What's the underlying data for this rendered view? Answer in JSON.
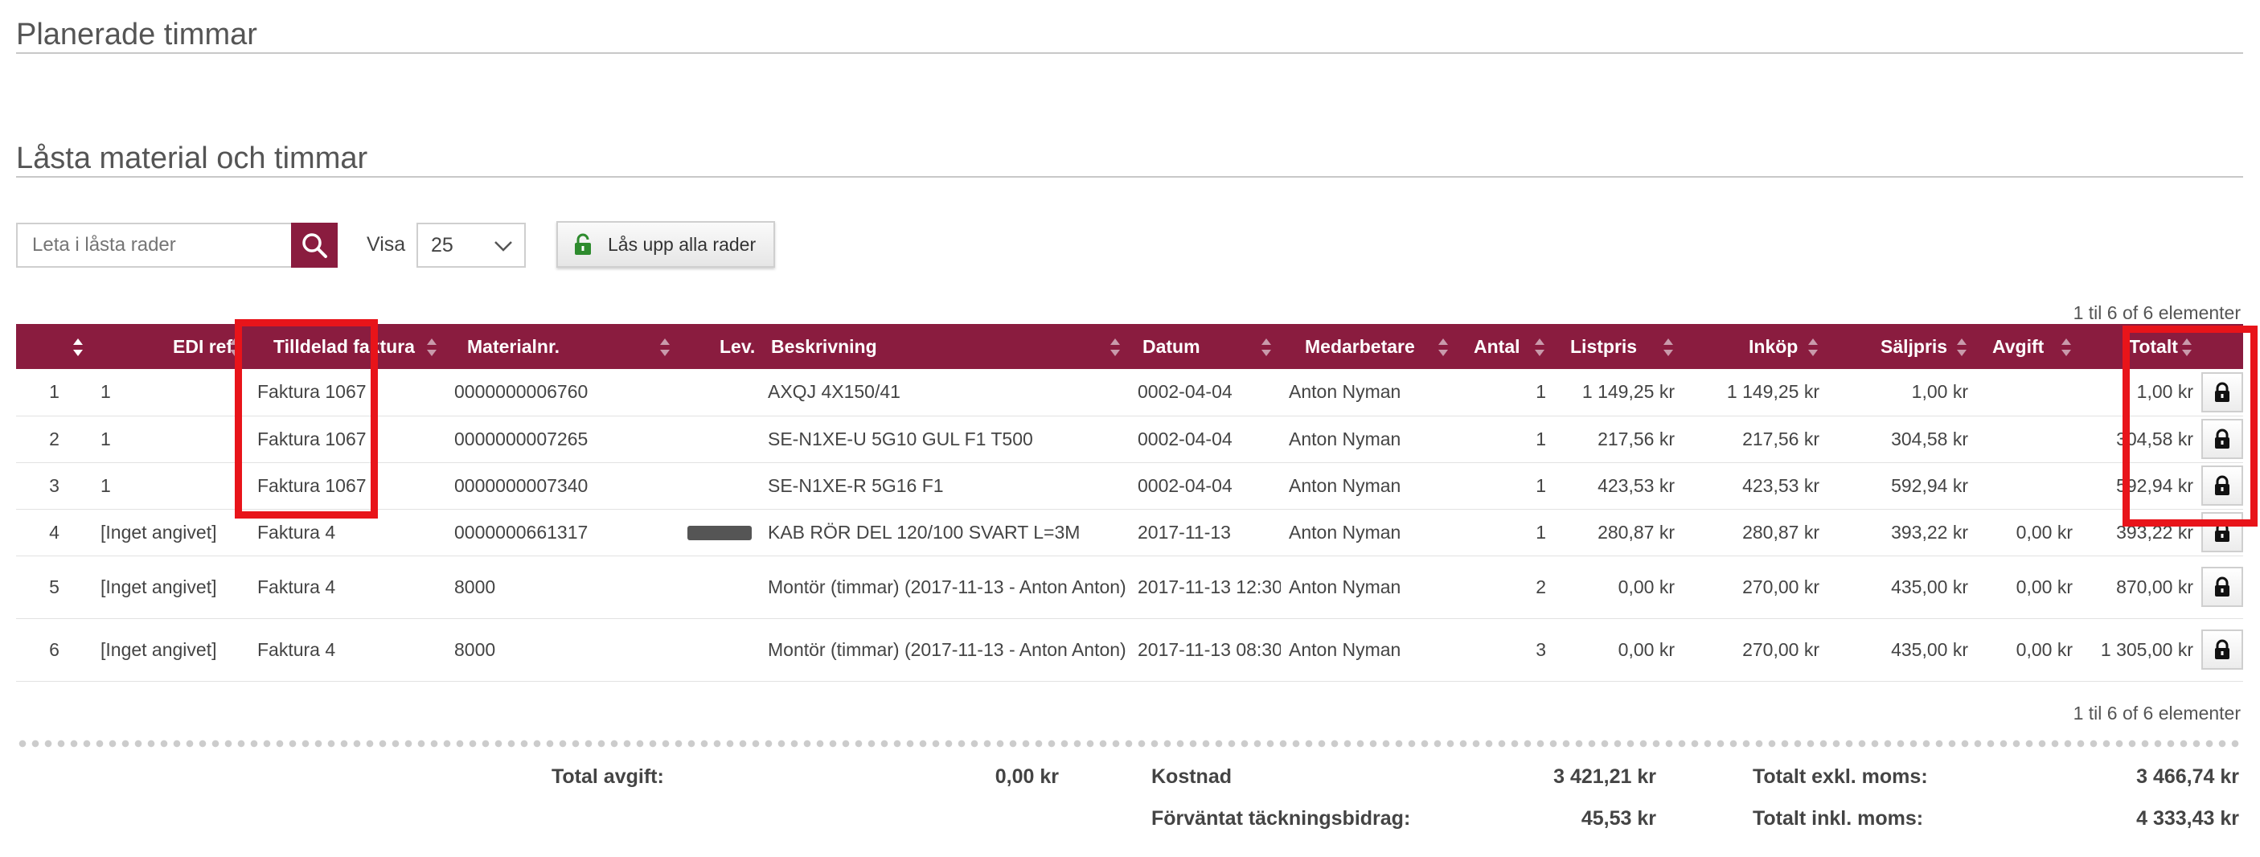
{
  "sections": {
    "planned_hours_title": "Planerade timmar",
    "locked_title": "Låsta material och timmar"
  },
  "toolbar": {
    "search_placeholder": "Leta i låsta rader",
    "show_label": "Visa",
    "page_size": "25",
    "unlock_all_label": "Lås upp alla rader"
  },
  "pager": {
    "top": "1 til 6 of 6 elementer",
    "bottom": "1 til 6 of 6 elementer"
  },
  "table": {
    "columns": [
      "",
      "EDI ref.",
      "Tilldelad faktura",
      "Materialnr.",
      "Lev.",
      "Beskrivning",
      "Datum",
      "Medarbetare",
      "Antal",
      "Listpris",
      "Inköp",
      "Säljpris",
      "Avgift",
      "Totalt",
      ""
    ],
    "rows": [
      {
        "n": "1",
        "edi": "1",
        "invoice": "Faktura 1067",
        "material": "0000000006760",
        "supplier": "",
        "description": "AXQJ 4X150/41",
        "date": "0002-04-04",
        "employee": "Anton Nyman",
        "qty": "1",
        "list": "1 149,25 kr",
        "purchase": "1 149,25 kr",
        "sale": "1,00 kr",
        "fee": "",
        "total": "1,00 kr"
      },
      {
        "n": "2",
        "edi": "1",
        "invoice": "Faktura 1067",
        "material": "0000000007265",
        "supplier": "",
        "description": "SE-N1XE-U 5G10 GUL F1 T500",
        "date": "0002-04-04",
        "employee": "Anton Nyman",
        "qty": "1",
        "list": "217,56 kr",
        "purchase": "217,56 kr",
        "sale": "304,58 kr",
        "fee": "",
        "total": "304,58 kr"
      },
      {
        "n": "3",
        "edi": "1",
        "invoice": "Faktura 1067",
        "material": "0000000007340",
        "supplier": "",
        "description": "SE-N1XE-R 5G16 F1",
        "date": "0002-04-04",
        "employee": "Anton Nyman",
        "qty": "1",
        "list": "423,53 kr",
        "purchase": "423,53 kr",
        "sale": "592,94 kr",
        "fee": "",
        "total": "592,94 kr"
      },
      {
        "n": "4",
        "edi": "[Inget angivet]",
        "invoice": "Faktura 4",
        "material": "0000000661317",
        "supplier": "redacted",
        "description": "KAB RÖR DEL 120/100 SVART L=3M",
        "date": "2017-11-13",
        "employee": "Anton Nyman",
        "qty": "1",
        "list": "280,87 kr",
        "purchase": "280,87 kr",
        "sale": "393,22 kr",
        "fee": "0,00 kr",
        "total": "393,22 kr"
      },
      {
        "n": "5",
        "edi": "[Inget angivet]",
        "invoice": "Faktura 4",
        "material": "8000",
        "supplier": "",
        "description": "Montör (timmar) (2017-11-13 - Anton Anton)",
        "date": "2017-11-13 12:30",
        "employee": "Anton Nyman",
        "qty": "2",
        "list": "0,00 kr",
        "purchase": "270,00 kr",
        "sale": "435,00 kr",
        "fee": "0,00 kr",
        "total": "870,00 kr"
      },
      {
        "n": "6",
        "edi": "[Inget angivet]",
        "invoice": "Faktura 4",
        "material": "8000",
        "supplier": "",
        "description": "Montör (timmar) (2017-11-13 - Anton Anton)",
        "date": "2017-11-13 08:30",
        "employee": "Anton Nyman",
        "qty": "3",
        "list": "0,00 kr",
        "purchase": "270,00 kr",
        "sale": "435,00 kr",
        "fee": "0,00 kr",
        "total": "1 305,00 kr"
      }
    ]
  },
  "summary": {
    "total_fee_label": "Total avgift:",
    "total_fee_value": "0,00 kr",
    "cost_label": "Kostnad",
    "cost_value": "3 421,21 kr",
    "expected_margin_label": "Förväntat täckningsbidrag:",
    "expected_margin_value": "45,53 kr",
    "total_excl_label": "Totalt exkl. moms:",
    "total_excl_value": "3 466,74 kr",
    "total_incl_label": "Totalt inkl. moms:",
    "total_incl_value": "4 333,43 kr"
  },
  "colors": {
    "header_bg": "#8a1c3f",
    "highlight": "#e8141a",
    "unlock_icon": "#2e8b2e"
  },
  "icons": [
    "search-icon",
    "chevron-down-icon",
    "unlock-icon",
    "lock-icon",
    "sort-icon"
  ]
}
